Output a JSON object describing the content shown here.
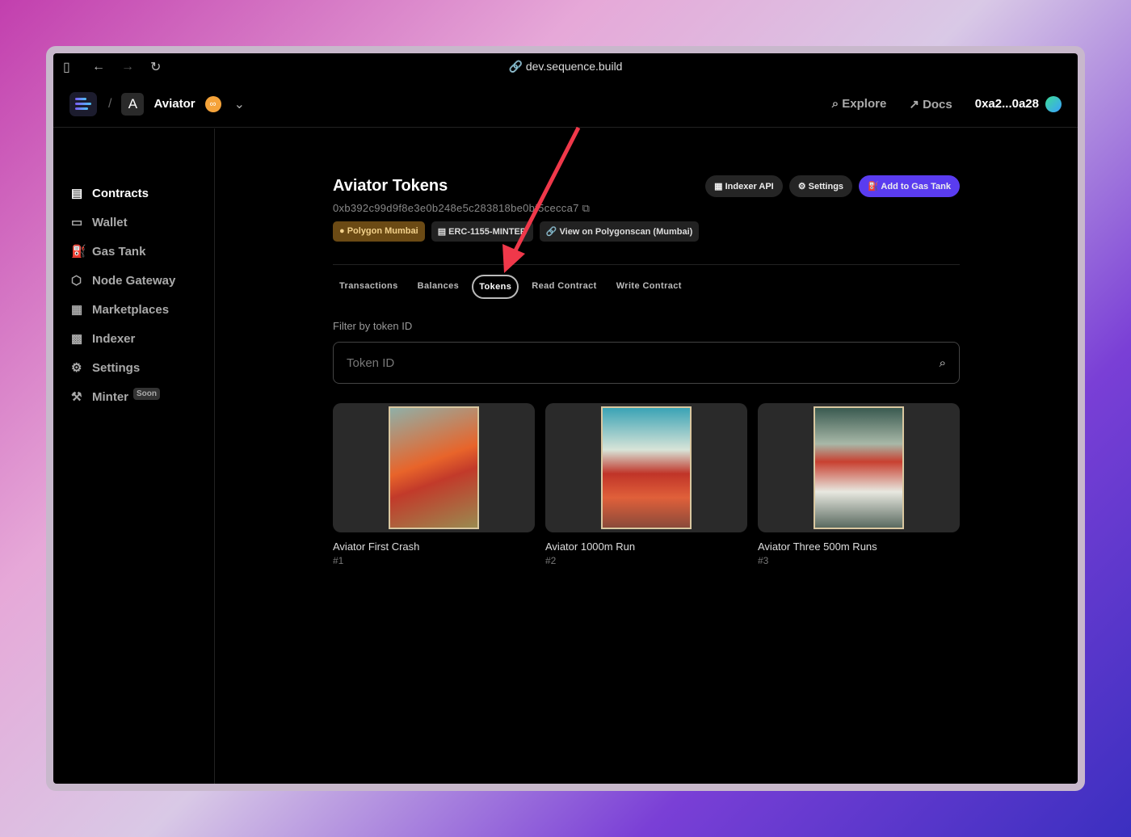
{
  "browser": {
    "url": "dev.sequence.build"
  },
  "header": {
    "project_initial": "A",
    "project_name": "Aviator",
    "explore": "Explore",
    "docs": "Docs",
    "account": "0xa2...0a28"
  },
  "sidebar": {
    "items": [
      {
        "label": "Contracts",
        "icon": "file-icon",
        "active": true
      },
      {
        "label": "Wallet",
        "icon": "wallet-icon"
      },
      {
        "label": "Gas Tank",
        "icon": "gas-icon"
      },
      {
        "label": "Node Gateway",
        "icon": "cube-icon"
      },
      {
        "label": "Marketplaces",
        "icon": "store-icon"
      },
      {
        "label": "Indexer",
        "icon": "grid-icon"
      },
      {
        "label": "Settings",
        "icon": "gear-icon"
      },
      {
        "label": "Minter",
        "icon": "mint-icon",
        "badge": "Soon"
      }
    ]
  },
  "contract": {
    "title": "Aviator Tokens",
    "address": "0xb392c99d9f8e3e0b248e5c283818be0bf5cecca7",
    "network": "Polygon Mumbai",
    "type": "ERC-1155-MINTER",
    "explorer": "View on Polygonscan (Mumbai)"
  },
  "actions": {
    "indexer": "Indexer API",
    "settings": "Settings",
    "gas_tank": "Add to Gas Tank"
  },
  "tabs": [
    "Transactions",
    "Balances",
    "Tokens",
    "Read Contract",
    "Write Contract"
  ],
  "active_tab": "Tokens",
  "filter": {
    "label": "Filter by token ID",
    "placeholder": "Token ID"
  },
  "tokens": [
    {
      "name": "Aviator First Crash",
      "id": "#1"
    },
    {
      "name": "Aviator 1000m Run",
      "id": "#2"
    },
    {
      "name": "Aviator Three 500m Runs",
      "id": "#3"
    }
  ],
  "colors": {
    "accent": "#5a3cf0",
    "annotation_arrow": "#f0384a"
  }
}
